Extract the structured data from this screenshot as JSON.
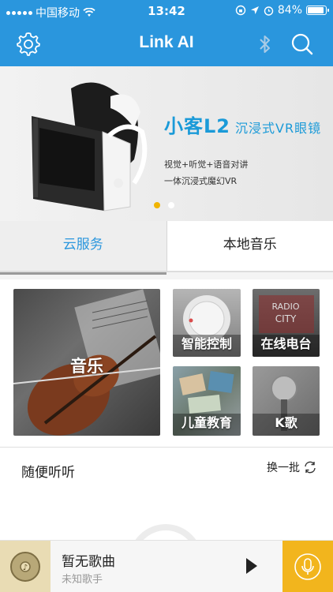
{
  "status": {
    "carrier": "中国移动",
    "time": "13:42",
    "battery": "84%",
    "battery_level": 0.84
  },
  "nav": {
    "title": "Link AI",
    "icons": [
      "settings-icon",
      "bluetooth-icon",
      "search-icon"
    ]
  },
  "banner": {
    "headline": "小客L2",
    "headline_sub": "沉浸式VR眼镜",
    "line1": "视觉+听觉+语音对讲",
    "line2": "一体沉浸式魔幻VR",
    "active_dot": 0
  },
  "tabs": [
    {
      "label": "云服务",
      "active": true
    },
    {
      "label": "本地音乐",
      "active": false
    }
  ],
  "grid": {
    "music": "音乐",
    "smart": "智能控制",
    "radio": "在线电台",
    "kids": "儿童教育",
    "ktv": "K歌"
  },
  "section": {
    "title": "随便听听",
    "refresh": "换一批"
  },
  "player": {
    "song": "暂无歌曲",
    "artist": "未知歌手"
  },
  "colors": {
    "primary": "#2a96dd",
    "accent": "#f2b51d",
    "banner_text": "#1a9ad8"
  }
}
